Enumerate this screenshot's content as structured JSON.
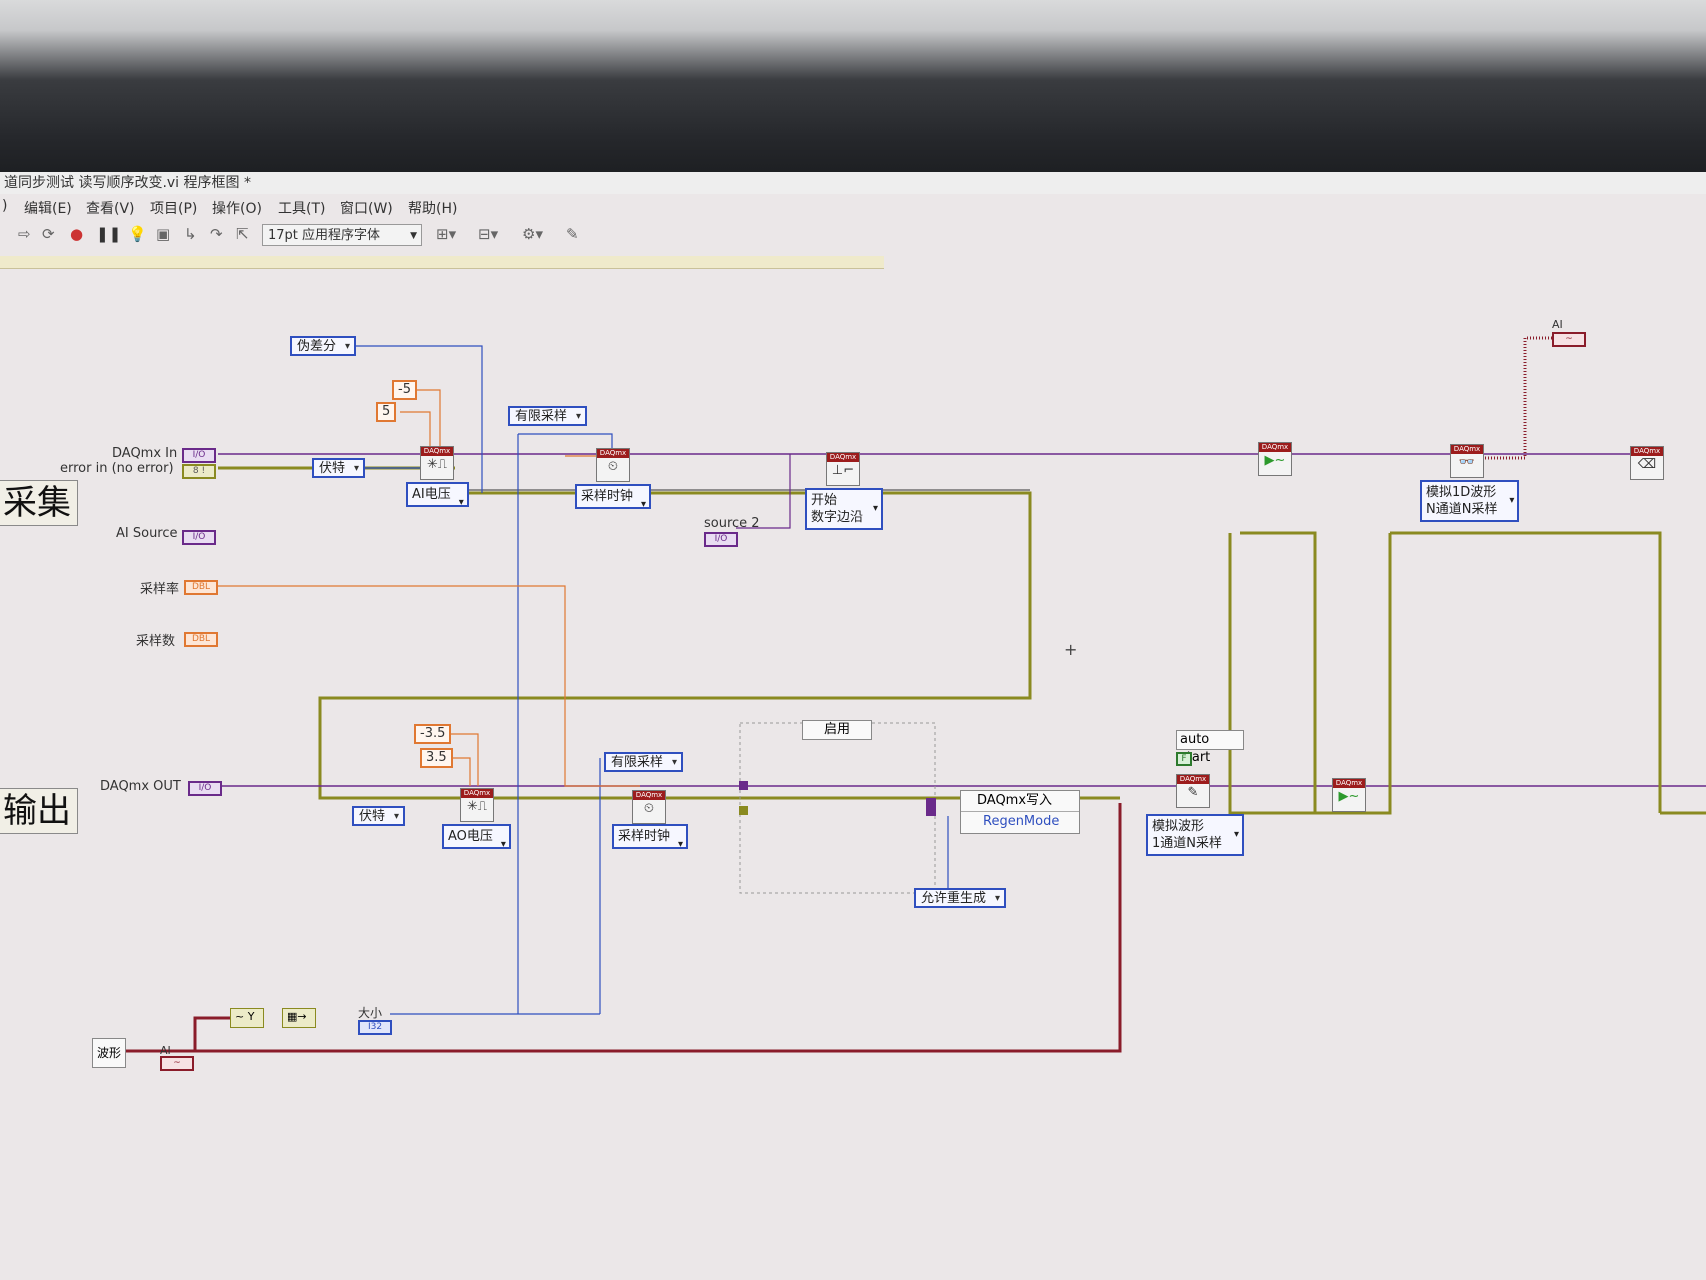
{
  "window": {
    "title": "道同步测试 读写顺序改变.vi 程序框图 *"
  },
  "menu": [
    {
      "label": ")"
    },
    {
      "label": "编辑(E)"
    },
    {
      "label": "查看(V)"
    },
    {
      "label": "项目(P)"
    },
    {
      "label": "操作(O)"
    },
    {
      "label": "工具(T)"
    },
    {
      "label": "窗口(W)"
    },
    {
      "label": "帮助(H)"
    }
  ],
  "toolbar": {
    "font_selector": "17pt 应用程序字体",
    "icons": [
      "run-arrow-icon",
      "run-continuous-icon",
      "abort-icon",
      "pause-icon",
      "highlight-execution-icon",
      "retain-wire-values-icon",
      "step-into-icon",
      "step-over-icon",
      "step-out-icon",
      "align-icon",
      "distribute-icon",
      "reorder-icon",
      "cleanup-icon"
    ]
  },
  "sections": {
    "acquire": "采集",
    "output": "输出"
  },
  "controls": {
    "daqmx_in": {
      "label": "DAQmx In",
      "type": "I/O"
    },
    "error_in": {
      "label": "error in (no error)",
      "type": "8 !"
    },
    "ai_source": {
      "label": "AI Source",
      "type": "I/O"
    },
    "sample_rate": {
      "label": "采样率",
      "type": "DBL"
    },
    "sample_count": {
      "label": "采样数",
      "type": "DBL"
    },
    "daqmx_out": {
      "label": "DAQmx OUT",
      "type": "I/O"
    },
    "source2": {
      "label": "source 2",
      "type": "I/O"
    },
    "waveform_ctrl": {
      "label": "波形"
    },
    "ai_small": {
      "label": "AI"
    },
    "ai_indicator": {
      "label": "AI"
    },
    "size_label": "大小",
    "size_type": "I32",
    "auto_start": "auto start",
    "auto_start_value": "F"
  },
  "constants": {
    "pseudo_diff": "伪差分",
    "minus5": "-5",
    "plus5": "5",
    "volts_ai": "伏特",
    "finite_ai": "有限采样",
    "minus35": "-3.5",
    "plus35": "3.5",
    "volts_ao": "伏特",
    "finite_ao": "有限采样",
    "allow_regen": "允许重生成",
    "enable": "启用"
  },
  "vis": {
    "ai_voltage": "AI电压",
    "sample_clock_ai": "采样时钟",
    "start_trigger": [
      "开始",
      "数字边沿"
    ],
    "ao_voltage": "AO电压",
    "sample_clock_ao": "采样时钟",
    "write_poly": [
      "模拟波形",
      "1通道N采样"
    ],
    "read_poly": [
      "模拟1D波形",
      "N通道N采样"
    ],
    "header": "DAQmx"
  },
  "property_node": {
    "title": "DAQmx写入",
    "property": "RegenMode"
  }
}
